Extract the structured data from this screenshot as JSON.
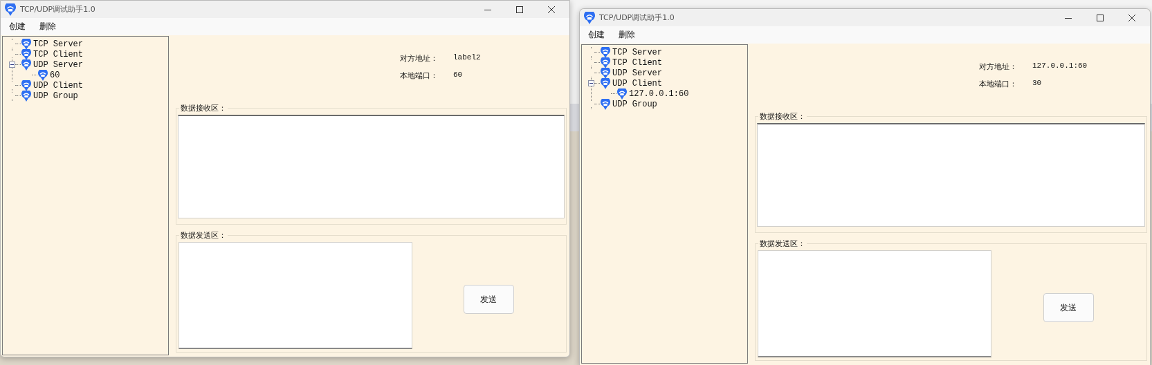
{
  "windows": [
    {
      "title": "TCP/UDP调试助手1.0",
      "menu": [
        "创建",
        "删除"
      ],
      "tree": [
        {
          "label": "TCP Server"
        },
        {
          "label": "TCP Client"
        },
        {
          "label": "UDP Server",
          "expanded": true,
          "children": [
            {
              "label": "60"
            }
          ]
        },
        {
          "label": "UDP Client"
        },
        {
          "label": "UDP Group"
        }
      ],
      "remote_address": {
        "label": "对方地址：",
        "value": "label2"
      },
      "local_port": {
        "label": "本地端口：",
        "value": "60"
      },
      "receive_group": {
        "title": "数据接收区："
      },
      "send_group": {
        "title": "数据发送区：",
        "button": "发送"
      }
    },
    {
      "title": "TCP/UDP调试助手1.0",
      "menu": [
        "创建",
        "删除"
      ],
      "tree": [
        {
          "label": "TCP Server"
        },
        {
          "label": "TCP Client"
        },
        {
          "label": "UDP Server"
        },
        {
          "label": "UDP Client",
          "expanded": true,
          "children": [
            {
              "label": "127.0.0.1:60"
            }
          ]
        },
        {
          "label": "UDP Group"
        }
      ],
      "remote_address": {
        "label": "对方地址：",
        "value": "127.0.0.1:60"
      },
      "local_port": {
        "label": "本地端口：",
        "value": "30"
      },
      "receive_group": {
        "title": "数据接收区："
      },
      "send_group": {
        "title": "数据发送区：",
        "button": "发送"
      }
    }
  ]
}
